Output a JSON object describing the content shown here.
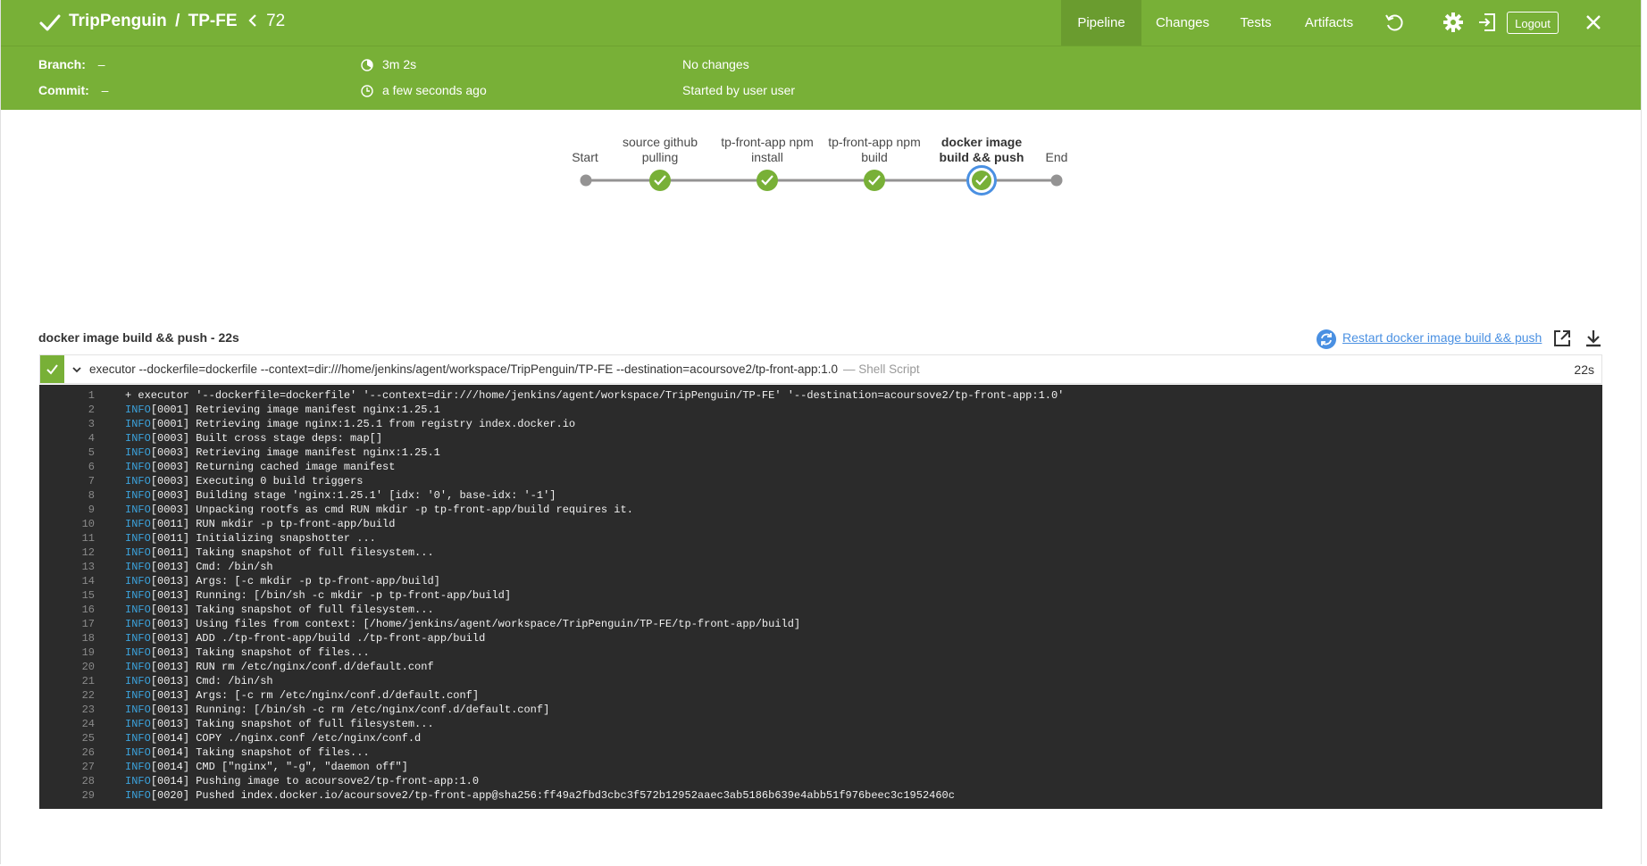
{
  "header": {
    "org": "TripPenguin",
    "separator": "/",
    "project": "TP-FE",
    "run_number": "72",
    "tabs": [
      {
        "label": "Pipeline",
        "active": true
      },
      {
        "label": "Changes",
        "active": false
      },
      {
        "label": "Tests",
        "active": false
      },
      {
        "label": "Artifacts",
        "active": false
      }
    ],
    "logout_label": "Logout",
    "icons": [
      "checkmark-icon",
      "back-chevron-icon",
      "replay-icon",
      "gear-icon",
      "exit-icon",
      "close-icon"
    ]
  },
  "meta": {
    "branch_label": "Branch:",
    "branch_value": "–",
    "commit_label": "Commit:",
    "commit_value": "–",
    "duration": "3m 2s",
    "started": "a few seconds ago",
    "changes": "No changes",
    "started_by": "Started by user user"
  },
  "pipeline": {
    "stages": [
      {
        "label": "Start",
        "status": "node"
      },
      {
        "label": "source github pulling",
        "status": "success"
      },
      {
        "label": "tp-front-app npm install",
        "status": "success"
      },
      {
        "label": "tp-front-app npm build",
        "status": "success"
      },
      {
        "label": "docker image build && push",
        "status": "success",
        "selected": true
      },
      {
        "label": "End",
        "status": "node"
      }
    ]
  },
  "step": {
    "title": "docker image build && push - 22s",
    "restart_label": "Restart docker image build && push",
    "command": "executor --dockerfile=dockerfile --context=dir:///home/jenkins/agent/workspace/TripPenguin/TP-FE --destination=acoursove2/tp-front-app:1.0",
    "type": "— Shell Script",
    "duration": "22s"
  },
  "log": [
    {
      "n": "1",
      "lvl": "",
      "text": "+ executor '--dockerfile=dockerfile' '--context=dir:///home/jenkins/agent/workspace/TripPenguin/TP-FE' '--destination=acoursove2/tp-front-app:1.0'"
    },
    {
      "n": "2",
      "lvl": "INFO",
      "text": "[0001] Retrieving image manifest nginx:1.25.1"
    },
    {
      "n": "3",
      "lvl": "INFO",
      "text": "[0001] Retrieving image nginx:1.25.1 from registry index.docker.io"
    },
    {
      "n": "4",
      "lvl": "INFO",
      "text": "[0003] Built cross stage deps: map[]"
    },
    {
      "n": "5",
      "lvl": "INFO",
      "text": "[0003] Retrieving image manifest nginx:1.25.1"
    },
    {
      "n": "6",
      "lvl": "INFO",
      "text": "[0003] Returning cached image manifest"
    },
    {
      "n": "7",
      "lvl": "INFO",
      "text": "[0003] Executing 0 build triggers"
    },
    {
      "n": "8",
      "lvl": "INFO",
      "text": "[0003] Building stage 'nginx:1.25.1' [idx: '0', base-idx: '-1']"
    },
    {
      "n": "9",
      "lvl": "INFO",
      "text": "[0003] Unpacking rootfs as cmd RUN mkdir -p tp-front-app/build requires it."
    },
    {
      "n": "10",
      "lvl": "INFO",
      "text": "[0011] RUN mkdir -p tp-front-app/build"
    },
    {
      "n": "11",
      "lvl": "INFO",
      "text": "[0011] Initializing snapshotter ..."
    },
    {
      "n": "12",
      "lvl": "INFO",
      "text": "[0011] Taking snapshot of full filesystem..."
    },
    {
      "n": "13",
      "lvl": "INFO",
      "text": "[0013] Cmd: /bin/sh"
    },
    {
      "n": "14",
      "lvl": "INFO",
      "text": "[0013] Args: [-c mkdir -p tp-front-app/build]"
    },
    {
      "n": "15",
      "lvl": "INFO",
      "text": "[0013] Running: [/bin/sh -c mkdir -p tp-front-app/build]"
    },
    {
      "n": "16",
      "lvl": "INFO",
      "text": "[0013] Taking snapshot of full filesystem..."
    },
    {
      "n": "17",
      "lvl": "INFO",
      "text": "[0013] Using files from context: [/home/jenkins/agent/workspace/TripPenguin/TP-FE/tp-front-app/build]"
    },
    {
      "n": "18",
      "lvl": "INFO",
      "text": "[0013] ADD ./tp-front-app/build ./tp-front-app/build"
    },
    {
      "n": "19",
      "lvl": "INFO",
      "text": "[0013] Taking snapshot of files..."
    },
    {
      "n": "20",
      "lvl": "INFO",
      "text": "[0013] RUN rm /etc/nginx/conf.d/default.conf"
    },
    {
      "n": "21",
      "lvl": "INFO",
      "text": "[0013] Cmd: /bin/sh"
    },
    {
      "n": "22",
      "lvl": "INFO",
      "text": "[0013] Args: [-c rm /etc/nginx/conf.d/default.conf]"
    },
    {
      "n": "23",
      "lvl": "INFO",
      "text": "[0013] Running: [/bin/sh -c rm /etc/nginx/conf.d/default.conf]"
    },
    {
      "n": "24",
      "lvl": "INFO",
      "text": "[0013] Taking snapshot of full filesystem..."
    },
    {
      "n": "25",
      "lvl": "INFO",
      "text": "[0014] COPY ./nginx.conf /etc/nginx/conf.d"
    },
    {
      "n": "26",
      "lvl": "INFO",
      "text": "[0014] Taking snapshot of files..."
    },
    {
      "n": "27",
      "lvl": "INFO",
      "text": "[0014] CMD [\"nginx\", \"-g\", \"daemon off\"]"
    },
    {
      "n": "28",
      "lvl": "INFO",
      "text": "[0014] Pushing image to acoursove2/tp-front-app:1.0"
    },
    {
      "n": "29",
      "lvl": "INFO",
      "text": "[0020] Pushed index.docker.io/acoursove2/tp-front-app@sha256:ff49a2fbd3cbc3f572b12952aaec3ab5186b639e4abb51f976beec3c1952460c"
    }
  ],
  "colors": {
    "header_green": "#78b037",
    "success_green": "#78b037",
    "selected_ring": "#4a90e2",
    "log_bg": "#2b2b2b",
    "log_level": "#3ba2dc",
    "link_blue": "#4a90e2"
  }
}
